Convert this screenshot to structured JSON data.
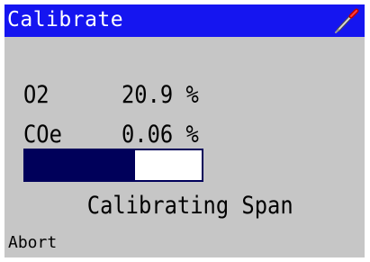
{
  "header": {
    "title": "Calibrate",
    "icon": "probe-icon",
    "background_color": "#1515f0"
  },
  "readings": [
    {
      "label": "O2",
      "value": "20.9 %"
    },
    {
      "label": "COe",
      "value": "0.06 %"
    }
  ],
  "progress": {
    "fraction": 0.62,
    "color": "#00005a"
  },
  "status_text": "Calibrating Span",
  "softkey": {
    "abort_label": "Abort"
  }
}
